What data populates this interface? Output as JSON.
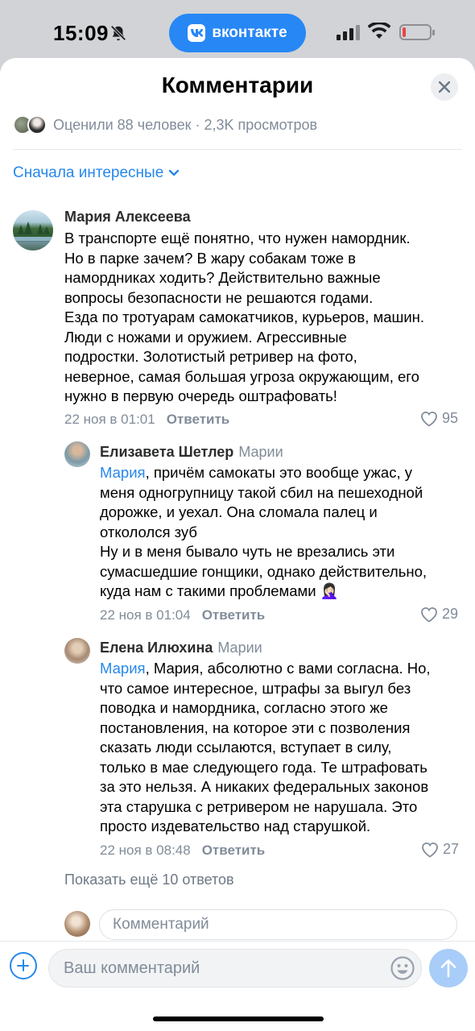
{
  "status_bar": {
    "time": "15:09",
    "app_pill": "вконтакте"
  },
  "sheet": {
    "title": "Комментарии",
    "stats": "Оценили 88 человек · 2,3K просмотров",
    "sort_label": "Сначала интересные"
  },
  "comments": [
    {
      "author": "Мария Алексеева",
      "reply_to": "",
      "mention": "",
      "lines": [
        "В транспорте ещё понятно, что нужен намордник.",
        "Но в парке зачем? В жару собакам тоже в",
        "намордниках ходить? Действительно важные",
        "вопросы безопасности не решаются годами.",
        "Езда по тротуарам самокатчиков, курьеров, машин.",
        "Люди с ножами и оружием. Агрессивные",
        "подростки. Золотистый ретривер на фото,",
        "неверное, самая большая угроза окружающим, его",
        "нужно в первую очередь оштрафовать!"
      ],
      "date": "22 ноя в 01:01",
      "reply_label": "Ответить",
      "likes": "95"
    },
    {
      "author": "Елизавета Шетлер",
      "reply_to": "Марии",
      "mention": "Мария",
      "lines": [
        ", причём самокаты это вообще ужас, у",
        "меня одногрупницу такой сбил на пешеходной",
        "дорожке, и уехал. Она сломала палец и",
        "откололся зуб",
        "Ну и в меня бывало чуть не врезались эти",
        "сумасшедшие гонщики, однако действительно,",
        "куда нам с такими проблемами 🤦🏻‍♀️"
      ],
      "date": "22 ноя в 01:04",
      "reply_label": "Ответить",
      "likes": "29"
    },
    {
      "author": "Елена Илюхина",
      "reply_to": "Марии",
      "mention": "Мария",
      "lines": [
        ", Мария, абсолютно с вами согласна. Но,",
        "что самое интересное, штрафы за выгул без",
        "поводка и намордника, согласно этого же",
        "постановления, на которое эти с позволения",
        "сказать люди ссылаются, вступает в силу,",
        "только в мае следующего года. Те штрафовать",
        "за это нельзя. А никаких  федеральных законов",
        "эта старушка с ретривером не нарушала. Это",
        "просто издевательство над старушкой."
      ],
      "date": "22 ноя в 08:48",
      "reply_label": "Ответить",
      "likes": "27"
    }
  ],
  "show_more": "Показать ещё 10 ответов",
  "inline_reply_placeholder": "Комментарий",
  "composer_placeholder": "Ваш комментарий",
  "colors": {
    "accent": "#2688eb",
    "secondary": "#818c99",
    "pill": "#2787f5"
  }
}
